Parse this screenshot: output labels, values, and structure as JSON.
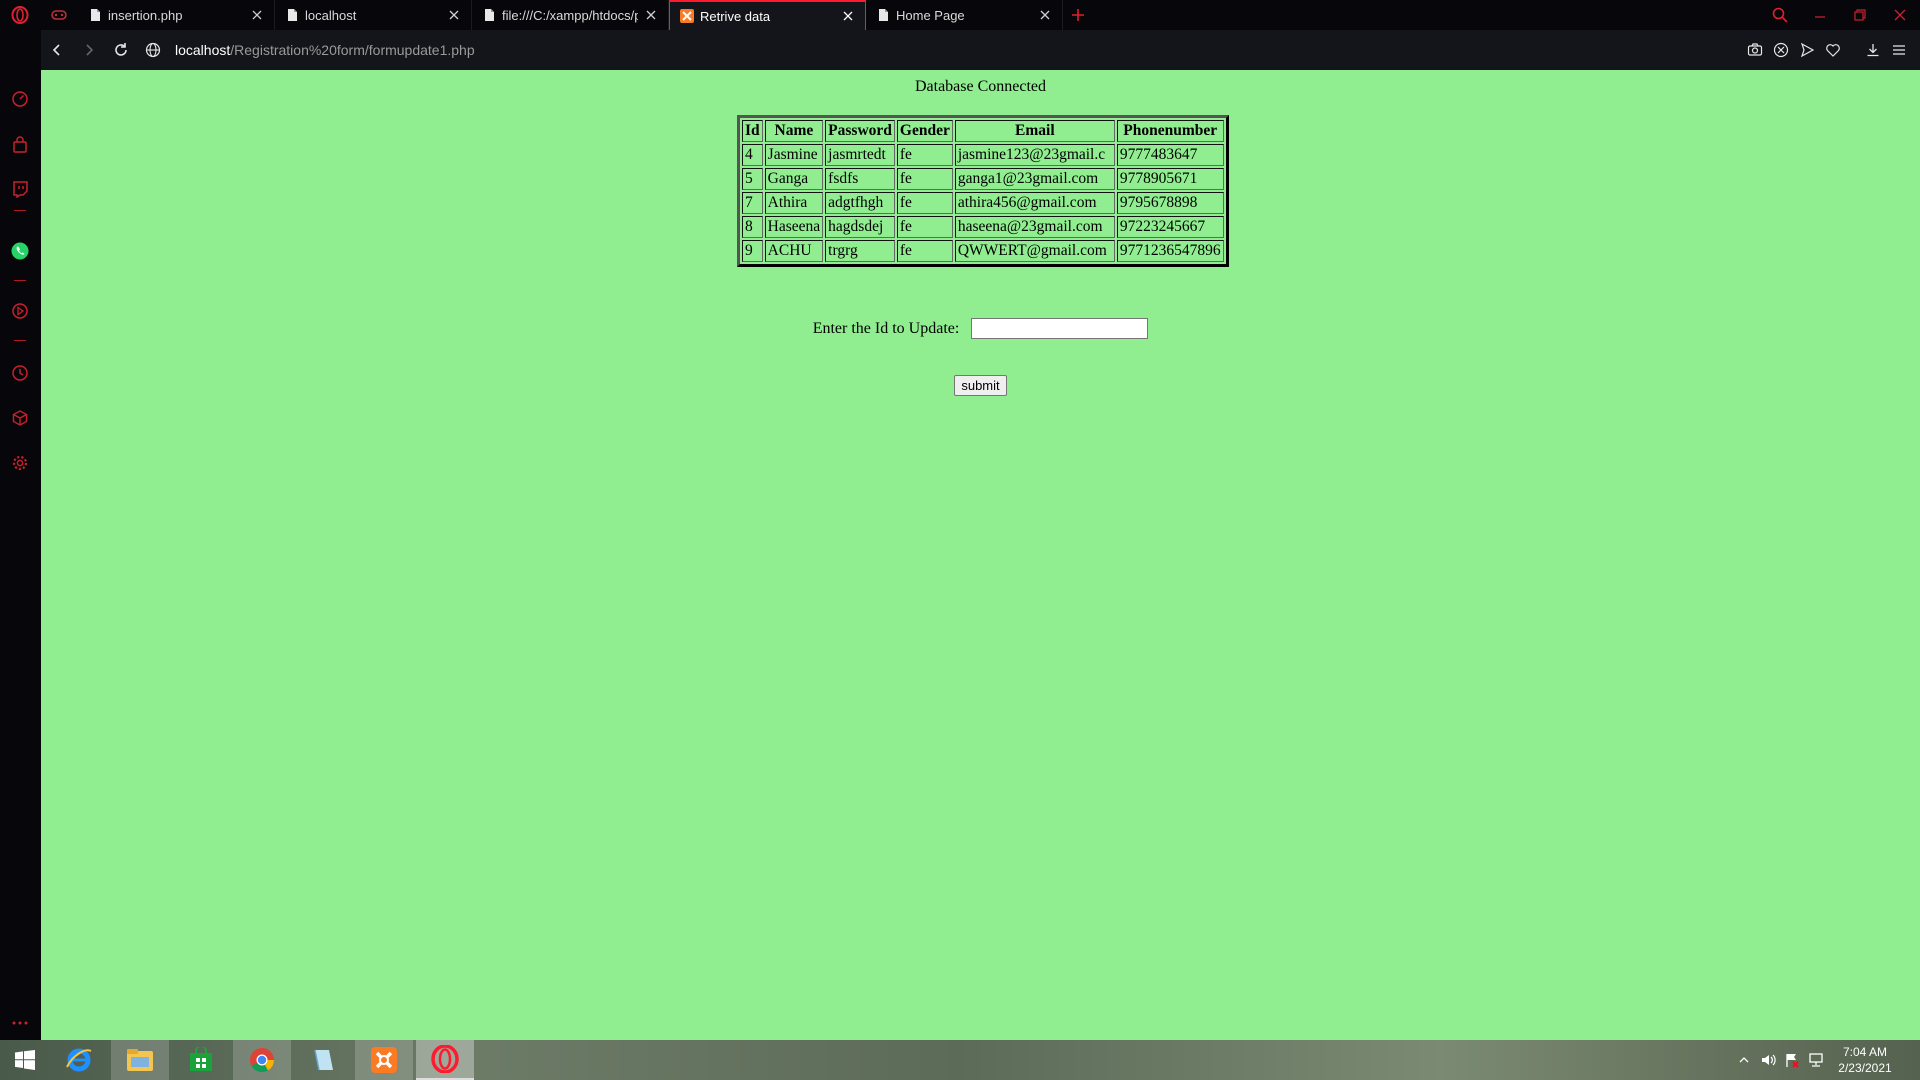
{
  "browser": {
    "tabs": [
      {
        "title": "insertion.php",
        "icon": "document-icon",
        "active": false
      },
      {
        "title": "localhost",
        "icon": "document-icon",
        "active": false
      },
      {
        "title": "file:///C:/xampp/htdocs/pr",
        "icon": "document-icon",
        "active": false
      },
      {
        "title": "Retrive data",
        "icon": "xampp-icon",
        "active": true
      },
      {
        "title": "Home Page",
        "icon": "document-icon",
        "active": false
      }
    ],
    "url_host": "localhost",
    "url_path": "/Registration%20form/formupdate1.php",
    "accent_color": "#ff1b2d"
  },
  "page": {
    "status": "Database Connected",
    "table": {
      "headers": [
        "Id",
        "Name",
        "Password",
        "Gender",
        "Email",
        "Phonenumber"
      ],
      "rows": [
        [
          "4",
          "Jasmine",
          "jasmrtedt",
          "fe",
          "jasmine123@23gmail.c",
          "9777483647"
        ],
        [
          "5",
          "Ganga",
          "fsdfs",
          "fe",
          "ganga1@23gmail.com",
          "9778905671"
        ],
        [
          "7",
          "Athira",
          "adgtfhgh",
          "fe",
          "athira456@gmail.com",
          "9795678898"
        ],
        [
          "8",
          "Haseena",
          "hagdsdej",
          "fe",
          "haseena@23gmail.com",
          "97223245667"
        ],
        [
          "9",
          "ACHU",
          "trgrg",
          "fe",
          "QWWERT@gmail.com",
          "9771236547896"
        ]
      ]
    },
    "form": {
      "label": "Enter the Id to Update:",
      "input_value": "",
      "submit_label": "submit"
    },
    "background_color": "#90ee90"
  },
  "taskbar": {
    "apps": [
      "internet-explorer-icon",
      "file-explorer-icon",
      "store-icon",
      "chrome-icon",
      "notepad-icon",
      "xampp-icon",
      "opera-icon"
    ],
    "time": "7:04 AM",
    "date": "2/23/2021"
  }
}
